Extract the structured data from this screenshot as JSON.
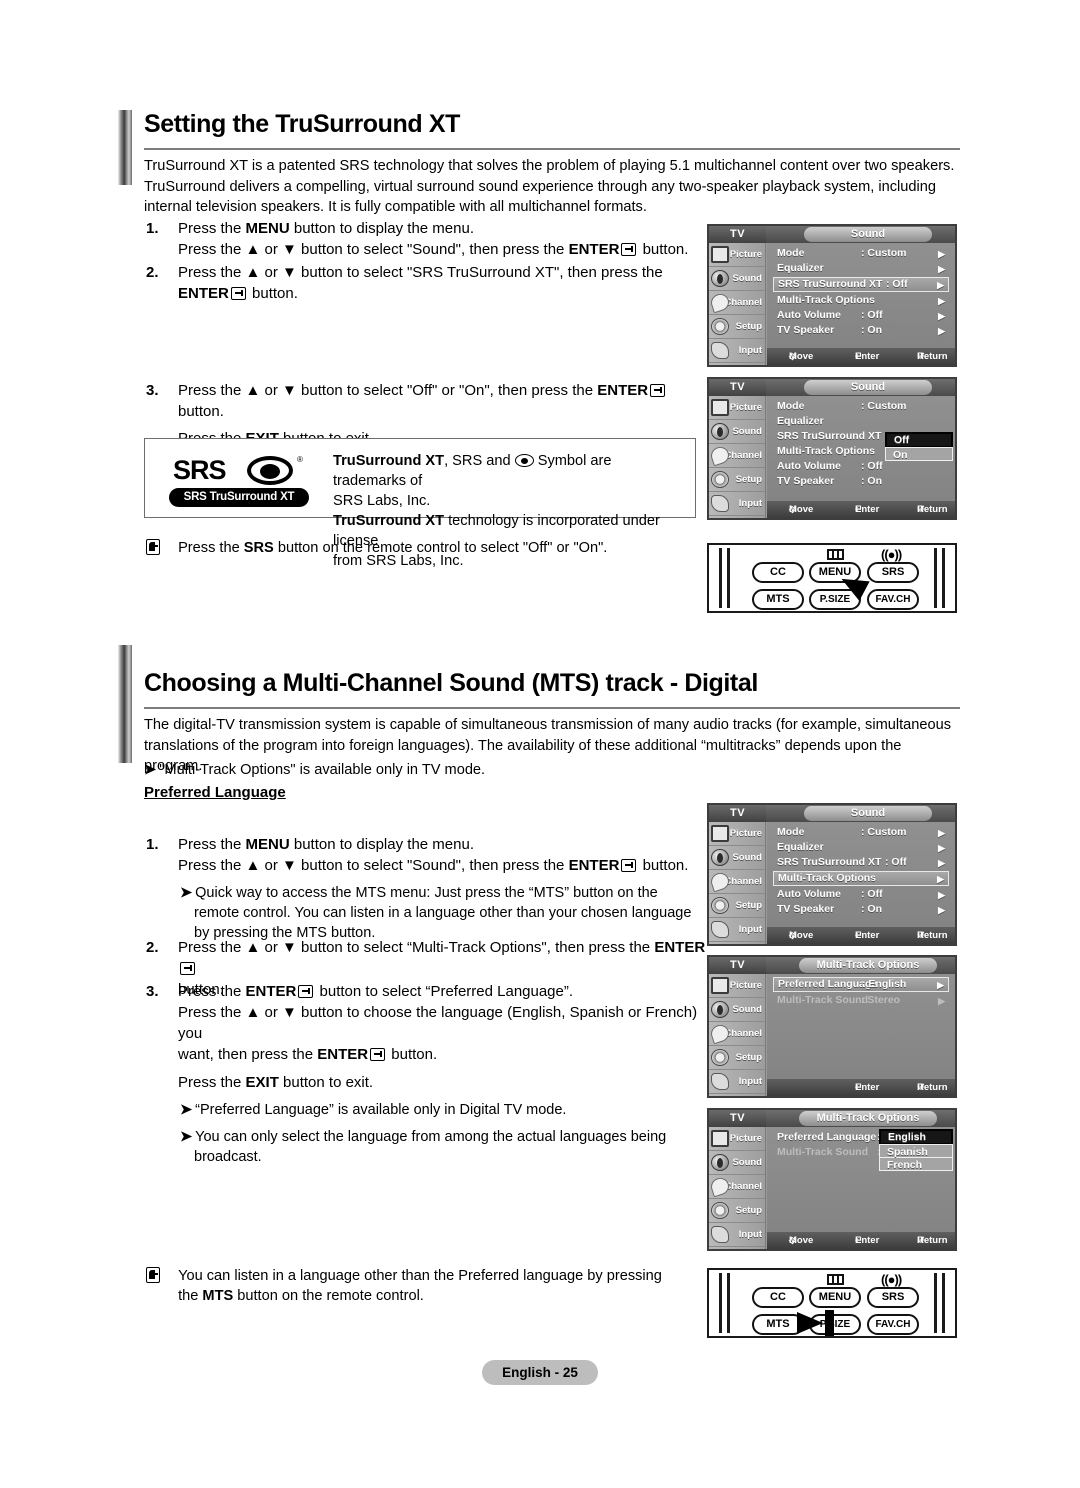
{
  "page": {
    "footer_label": "English - 25"
  },
  "section1": {
    "heading": "Setting the TruSurround XT",
    "intro": "TruSurround XT is a patented SRS technology that solves the problem of playing 5.1 multichannel content over two speakers. TruSurround delivers a compelling, virtual surround sound experience through any two-speaker playback system, including internal television speakers. It is fully compatible with all multichannel formats.",
    "step1": {
      "num": "1.",
      "line1_a": "Press the ",
      "line1_b": "MENU",
      "line1_c": " button to display the menu.",
      "line2_a": "Press the ▲ or ▼ button to select \"Sound\", then press the ",
      "line2_b": "ENTER",
      "line2_c": " button."
    },
    "step2": {
      "num": "2.",
      "line1": "Press the ▲ or ▼ button to select \"SRS TruSurround XT\", then press the",
      "line2_a": "ENTER",
      "line2_b": " button."
    },
    "step3": {
      "num": "3.",
      "line1_a": "Press the ▲ or ▼ button to select \"Off\" or \"On\", then press the ",
      "line1_b": "ENTER",
      "line1_c": " button.",
      "line2_a": "Press the ",
      "line2_b": "EXIT",
      "line2_c": " button to exit."
    },
    "trademark": {
      "logo_word": "SRS",
      "logo_pill": "SRS TruSurround XT",
      "line1_a": "TruSurround XT",
      "line1_b": ", SRS and ",
      "line1_c": " Symbol are trademarks of",
      "line2": "SRS Labs, Inc.",
      "line3_a": "TruSurround XT",
      "line3_b": " technology is incorporated under license",
      "line4": "from SRS Labs, Inc."
    },
    "note": {
      "a": "Press the ",
      "b": "SRS",
      "c": " button on the remote control to select \"Off\" or \"On\"."
    }
  },
  "section2": {
    "heading": "Choosing a Multi-Channel Sound (MTS) track - Digital",
    "intro": "The digital-TV transmission system is capable of simultaneous transmission of many audio tracks (for example, simultaneous translations of the program into foreign languages). The availability of these additional “multitracks” depends upon the program.",
    "tip_top": "\"Multi-Track Options\" is available only in TV mode.",
    "subheading": "Preferred Language",
    "step1": {
      "num": "1.",
      "line1_a": "Press the ",
      "line1_b": "MENU",
      "line1_c": " button to display the menu.",
      "line2_a": "Press the ▲ or ▼ button to select \"Sound\", then press the ",
      "line2_b": "ENTER",
      "line2_c": " button.",
      "tip": "Quick way to access the MTS menu: Just press the “MTS” button on the remote control. You can listen in a language other than your chosen language by pressing the MTS button."
    },
    "step2": {
      "num": "2.",
      "line1_a": "Press the ▲ or ▼ button to select “Multi-Track Options\", then press the ",
      "line1_b": "ENTER",
      "line2": "button."
    },
    "step3": {
      "num": "3.",
      "line1_a": "Press the ",
      "line1_b": "ENTER",
      "line1_c": " button to select “Preferred Language”.",
      "line2": "Press the ▲ or ▼ button to choose the language (English, Spanish or French) you",
      "line3_a": "want, then press the ",
      "line3_b": "ENTER",
      "line3_c": " button.",
      "line4_a": "Press the ",
      "line4_b": "EXIT",
      "line4_c": " button to exit.",
      "tip1": "“Preferred Language” is available only in Digital TV mode.",
      "tip2": "You can only select the language from among the actual languages being broadcast."
    },
    "note": {
      "a": "You can listen in a language other than the Preferred language by pressing",
      "b": "the ",
      "c": "MTS",
      "d": " button on the remote control."
    }
  },
  "osd_common": {
    "tv_label": "TV",
    "sidebar": [
      {
        "label": "Picture",
        "icon": "picture-icon"
      },
      {
        "label": "Sound",
        "icon": "speaker-icon"
      },
      {
        "label": "Channel",
        "icon": "satellite-dish-icon"
      },
      {
        "label": "Setup",
        "icon": "gear-icon"
      },
      {
        "label": "Input",
        "icon": "input-plug-icon"
      }
    ],
    "footer": {
      "move": "Move",
      "enter": "Enter",
      "return": "Return"
    }
  },
  "osd1": {
    "title": "Sound",
    "rows": [
      {
        "label": "Mode",
        "value": ": Custom",
        "arrow": "▶",
        "selected": false
      },
      {
        "label": "Equalizer",
        "value": "",
        "arrow": "▶",
        "selected": false
      },
      {
        "label": "SRS TruSurround XT",
        "value": ": Off",
        "arrow": "▶",
        "selected": true
      },
      {
        "label": "Multi-Track Options",
        "value": "",
        "arrow": "▶",
        "selected": false
      },
      {
        "label": "Auto Volume",
        "value": ": Off",
        "arrow": "▶",
        "selected": false
      },
      {
        "label": "TV Speaker",
        "value": ": On",
        "arrow": "▶",
        "selected": false
      }
    ]
  },
  "osd2": {
    "title": "Sound",
    "rows": [
      {
        "label": "Mode",
        "value": ": Custom",
        "arrow": "",
        "selected": false
      },
      {
        "label": "Equalizer",
        "value": "",
        "arrow": "",
        "selected": false
      },
      {
        "label": "SRS TruSurround XT",
        "value": ":",
        "arrow": "",
        "selected": false
      },
      {
        "label": "Multi-Track Options",
        "value": "",
        "arrow": "",
        "selected": false
      },
      {
        "label": "Auto Volume",
        "value": ": Off",
        "arrow": "",
        "selected": false
      },
      {
        "label": "TV Speaker",
        "value": ": On",
        "arrow": "",
        "selected": false
      }
    ],
    "dropdown": {
      "options": [
        "Off",
        "On"
      ],
      "current": "Off"
    }
  },
  "osd3": {
    "title": "Sound",
    "rows": [
      {
        "label": "Mode",
        "value": ": Custom",
        "arrow": "▶",
        "selected": false
      },
      {
        "label": "Equalizer",
        "value": "",
        "arrow": "▶",
        "selected": false
      },
      {
        "label": "SRS TruSurround XT",
        "value": ": Off",
        "arrow": "▶",
        "selected": false
      },
      {
        "label": "Multi-Track Options",
        "value": "",
        "arrow": "▶",
        "selected": true
      },
      {
        "label": "Auto Volume",
        "value": ": Off",
        "arrow": "▶",
        "selected": false
      },
      {
        "label": "TV Speaker",
        "value": ": On",
        "arrow": "▶",
        "selected": false
      }
    ]
  },
  "osd4": {
    "title": "Multi-Track Options",
    "rows": [
      {
        "label": "Preferred Language",
        "value": ": English",
        "arrow": "▶",
        "selected": true,
        "dim": false
      },
      {
        "label": "Multi-Track Sound",
        "value": ": Stereo",
        "arrow": "▶",
        "selected": false,
        "dim": true
      }
    ],
    "footer": {
      "enter": "Enter",
      "return": "Return"
    }
  },
  "osd5": {
    "title": "Multi-Track Options",
    "rows": [
      {
        "label": "Preferred Language",
        "value": ":",
        "arrow": "",
        "selected": false,
        "dim": false
      },
      {
        "label": "Multi-Track Sound",
        "value": ":",
        "arrow": "",
        "selected": false,
        "dim": true
      }
    ],
    "dropdown": {
      "options": [
        "English",
        "Spanish",
        "French"
      ],
      "current": "English"
    }
  },
  "remote1": {
    "menu_glyph": "menu-bars-icon",
    "srs_glyph": "((●))",
    "buttons": [
      "CC",
      "MENU",
      "SRS",
      "MTS",
      "P.SIZE",
      "FAV.CH"
    ],
    "pointer_target": "SRS"
  },
  "remote2": {
    "menu_glyph": "menu-bars-icon",
    "srs_glyph": "((●))",
    "buttons": [
      "CC",
      "MENU",
      "SRS",
      "MTS",
      "P.SIZE",
      "FAV.CH"
    ],
    "pointer_target": "MTS"
  }
}
